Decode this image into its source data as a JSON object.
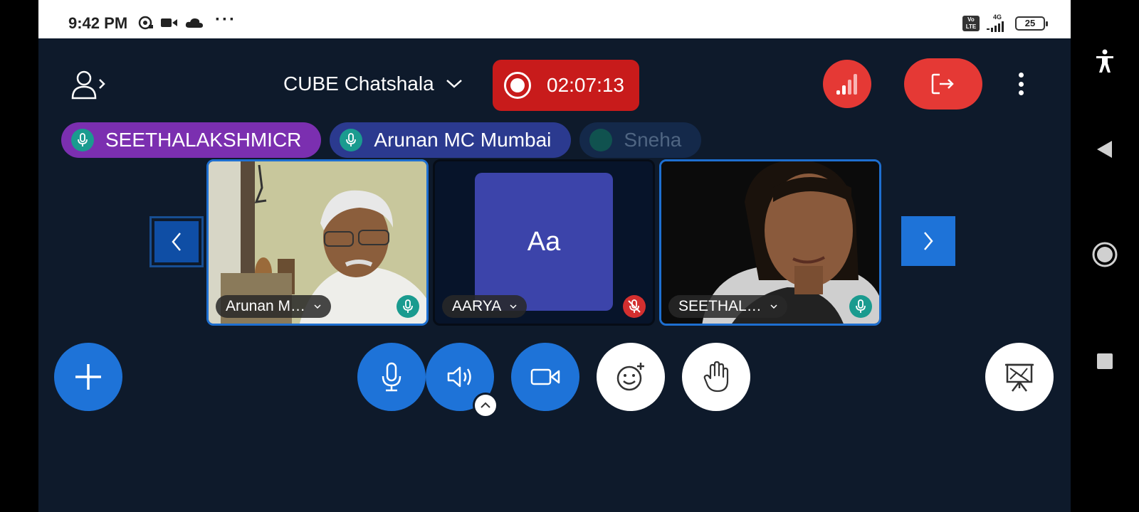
{
  "status_bar": {
    "time": "9:42 PM",
    "more": "···",
    "volte": "Vo LTE",
    "network": "4G",
    "battery": "25"
  },
  "header": {
    "room_name": "CUBE Chatshala",
    "recording_time": "02:07:13"
  },
  "talkers": [
    {
      "name": "SEETHALAKSHMICR"
    },
    {
      "name": "Arunan MC Mumbai"
    },
    {
      "name": "Sneha"
    }
  ],
  "tiles": [
    {
      "name": "Arunan M…",
      "muted": false
    },
    {
      "name": "AARYA",
      "avatar_initials": "Aa",
      "muted": true
    },
    {
      "name": "SEETHAL…",
      "muted": false
    }
  ],
  "colors": {
    "background": "#0e1a2b",
    "accent": "#1e73d8",
    "danger": "#e53935",
    "recording": "#c81b1b"
  },
  "icons": {
    "user_list": "user-list-icon",
    "chevron": "chevron-down-icon",
    "connection": "signal-bars-icon",
    "leave": "leave-icon",
    "more": "more-vertical-icon",
    "add": "plus-icon",
    "mic": "microphone-icon",
    "audio": "speaker-icon",
    "camera": "video-camera-icon",
    "emoji": "emoji-add-icon",
    "raise_hand": "hand-icon",
    "presentation": "presentation-icon"
  }
}
